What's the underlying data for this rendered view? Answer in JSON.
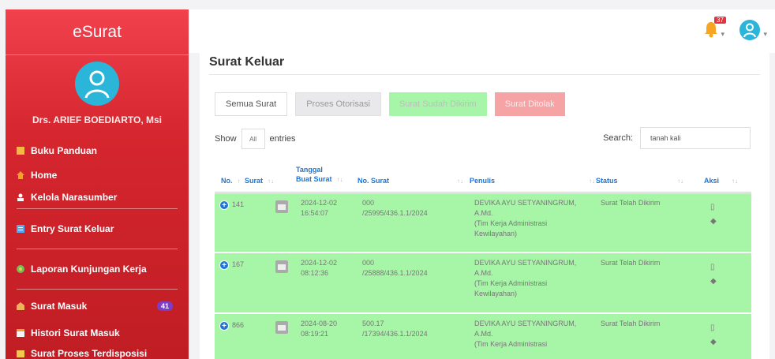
{
  "app": {
    "brand": "eSurat"
  },
  "profile": {
    "name": "Drs. ARIEF BOEDIARTO, Msi"
  },
  "menu": [
    {
      "label": "Buku Panduan",
      "icon": "book-icon"
    },
    {
      "label": "Home",
      "icon": "home-icon"
    },
    {
      "label": "Kelola Narasumber",
      "icon": "user-icon"
    },
    {
      "label": "Entry Surat Keluar",
      "icon": "edit-icon"
    },
    {
      "label": "Laporan Kunjungan Kerja",
      "icon": "report-icon"
    },
    {
      "label": "Surat Masuk",
      "icon": "inbox-icon",
      "badge": "41"
    },
    {
      "label": "Histori Surat Masuk",
      "icon": "history-icon"
    },
    {
      "label": "Surat Proses Terdisposisi",
      "icon": "disposition-icon"
    }
  ],
  "topbar": {
    "notif_count": "37"
  },
  "page": {
    "title": "Surat Keluar"
  },
  "tabs": [
    {
      "label": "Semua Surat"
    },
    {
      "label": "Proses Otorisasi"
    },
    {
      "label": "Surat Sudah Dikirim"
    },
    {
      "label": "Surat Ditolak"
    }
  ],
  "table_controls": {
    "show_label": "Show",
    "show_value": "All",
    "entries_label": "entries",
    "search_label": "Search:",
    "search_value": "tanah kali"
  },
  "table": {
    "headers": {
      "no": "No.",
      "surat": "Surat",
      "tanggal_1": "Tanggal",
      "tanggal_2": "Buat Surat",
      "no_surat": "No. Surat",
      "penulis": "Penulis",
      "status": "Status",
      "aksi": "Aksi"
    },
    "rows": [
      {
        "no": "141",
        "date": "2024-12-02",
        "time": "16:54:07",
        "nosurat_1": "000",
        "nosurat_2": "/25995/436.1.1/2024",
        "penulis_1": "DEVIKA AYU SETYANINGRUM,",
        "penulis_2": "A.Md.",
        "penulis_3": "(Tim Kerja Administrasi",
        "penulis_4": "Kewilayahan)",
        "status": "Surat Telah Dikirim"
      },
      {
        "no": "167",
        "date": "2024-12-02",
        "time": "08:12:36",
        "nosurat_1": "000",
        "nosurat_2": "/25888/436.1.1/2024",
        "penulis_1": "DEVIKA AYU SETYANINGRUM,",
        "penulis_2": "A.Md.",
        "penulis_3": "(Tim Kerja Administrasi",
        "penulis_4": "Kewilayahan)",
        "status": "Surat Telah Dikirim"
      },
      {
        "no": "866",
        "date": "2024-08-20",
        "time": "08:19:21",
        "nosurat_1": "500.17",
        "nosurat_2": "/17394/436.1.1/2024",
        "penulis_1": "DEVIKA AYU SETYANINGRUM,",
        "penulis_2": "A.Md.",
        "penulis_3": "(Tim Kerja Administrasi",
        "penulis_4": "",
        "status": "Surat Telah Dikirim"
      }
    ]
  },
  "colors": {
    "sidebar": "#d6262f",
    "sent_row": "#a7f5a7",
    "link": "#1d73d6"
  }
}
